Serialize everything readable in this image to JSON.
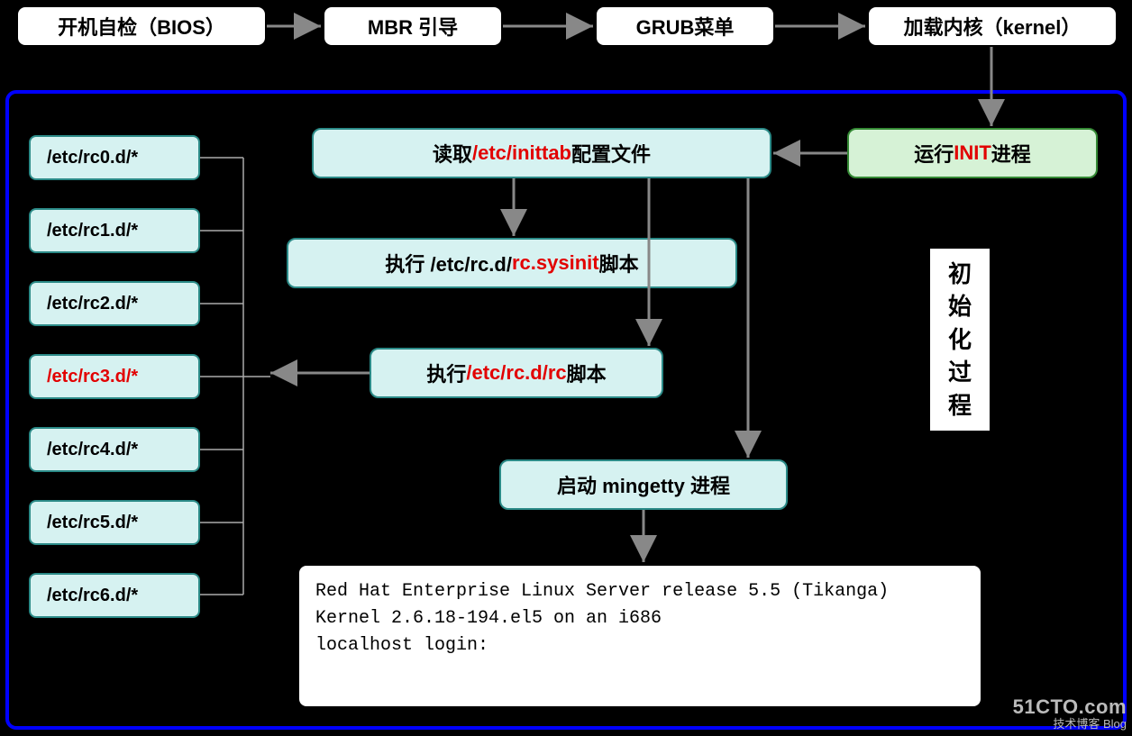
{
  "top_row": {
    "bios": "开机自检（BIOS）",
    "mbr": "MBR 引导",
    "grub": "GRUB菜单",
    "kernel": "加载内核（kernel）"
  },
  "init_box": {
    "prefix": "运行 ",
    "highlight": "INIT",
    "suffix": " 进程"
  },
  "inittab_box": {
    "prefix": "读取",
    "highlight": "/etc/inittab",
    "suffix": "配置文件"
  },
  "sysinit_box": {
    "prefix": "执行 /etc/rc.d/",
    "highlight": "rc.sysinit",
    "suffix": " 脚本"
  },
  "rc_box": {
    "prefix": "执行",
    "highlight": "/etc/rc.d/rc",
    "suffix": "脚本"
  },
  "mingetty_box": "启动 mingetty 进程",
  "rc_levels": [
    {
      "prefix": "/etc/rc0.d/*",
      "highlight": false
    },
    {
      "prefix": "/etc/rc1.d/*",
      "highlight": false
    },
    {
      "prefix": "/etc/rc2.d/*",
      "highlight": false
    },
    {
      "prefix": "/etc/rc3.d/*",
      "highlight": true
    },
    {
      "prefix": "/etc/rc4.d/*",
      "highlight": false
    },
    {
      "prefix": "/etc/rc5.d/*",
      "highlight": false
    },
    {
      "prefix": "/etc/rc6.d/*",
      "highlight": false
    }
  ],
  "side_label": "初\n始\n化\n过\n程",
  "terminal": {
    "line1": "Red Hat Enterprise Linux Server release 5.5 (Tikanga)",
    "line2": "Kernel 2.6.18-194.el5 on an i686",
    "line3": "",
    "line4": "localhost login:"
  },
  "watermark": {
    "big": "51CTO.com",
    "small": "技术博客  Blog"
  }
}
